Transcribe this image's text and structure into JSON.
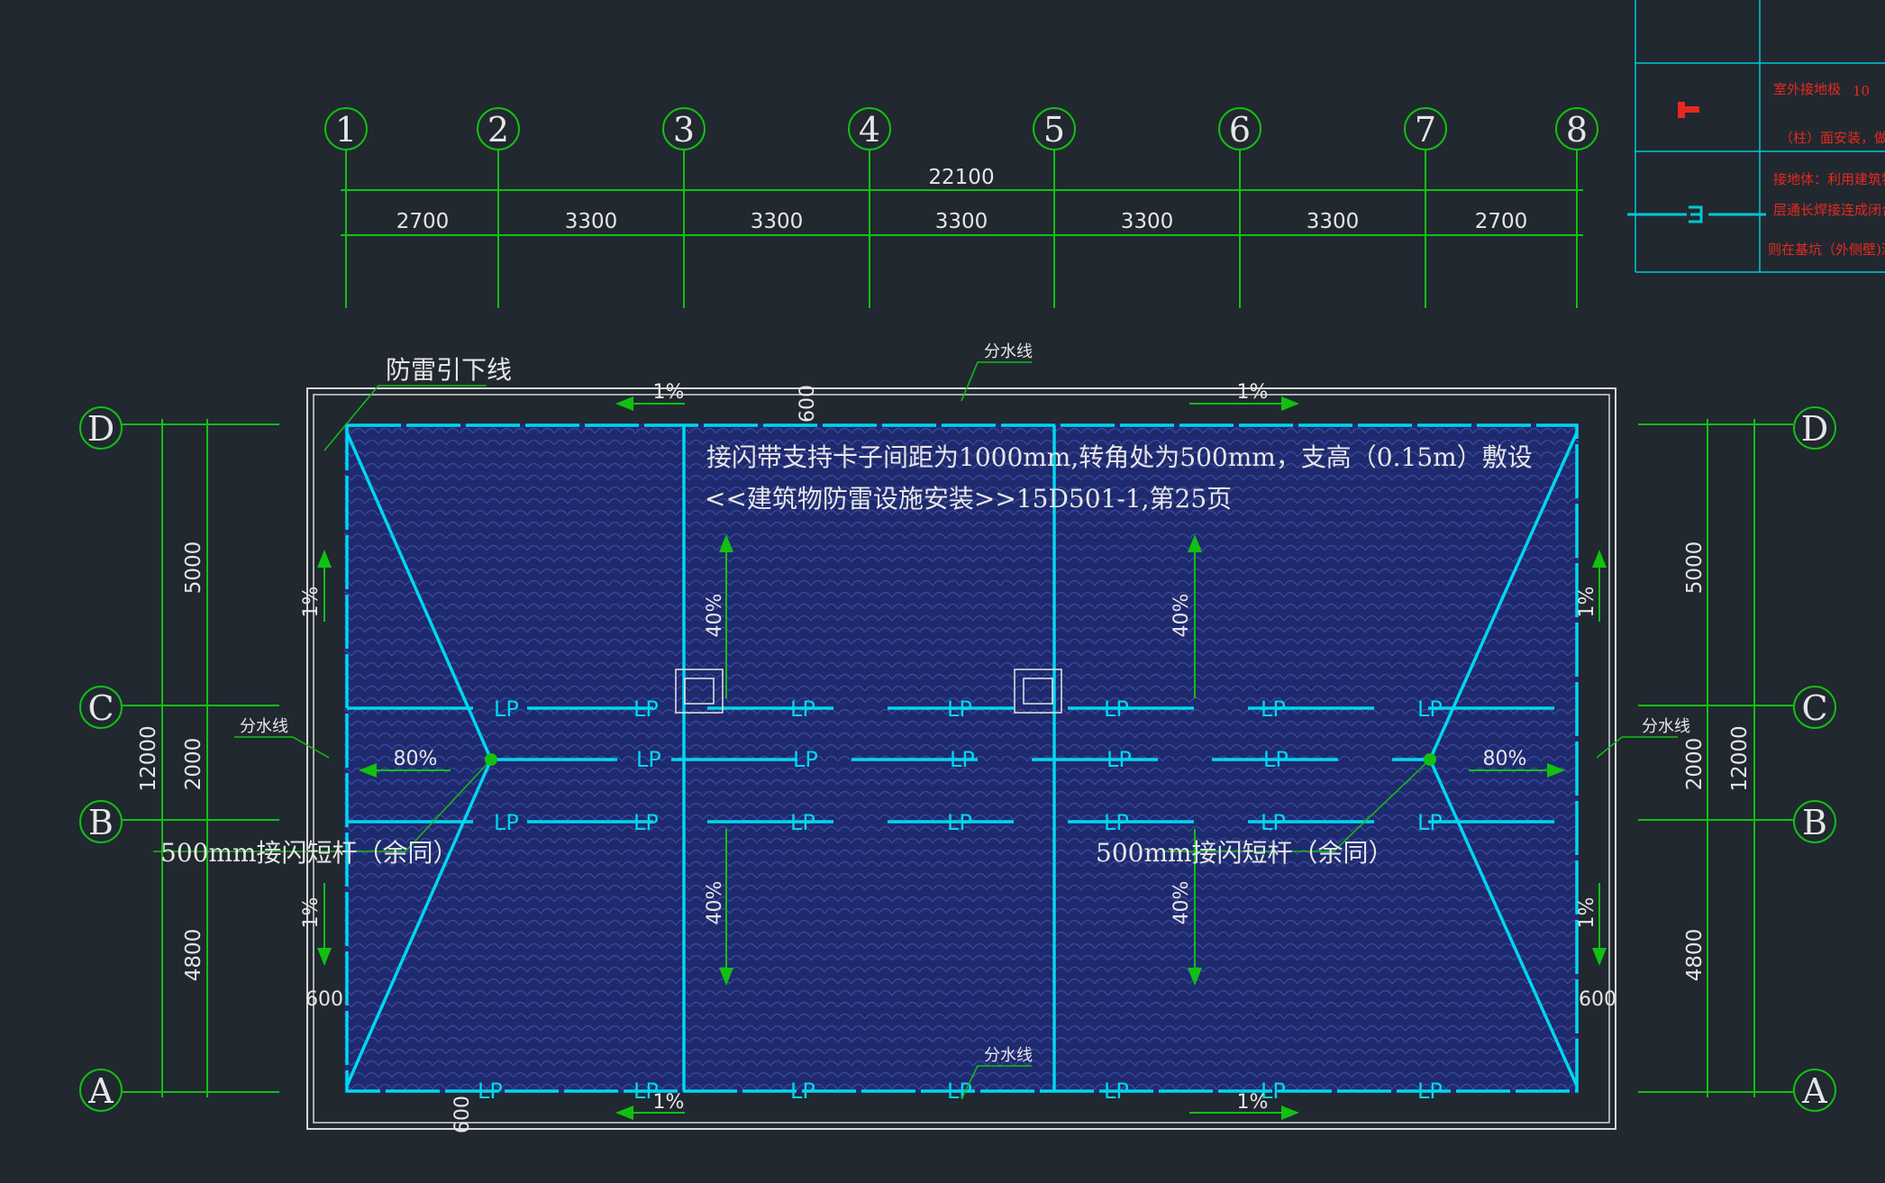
{
  "axes_top": [
    "1",
    "2",
    "3",
    "4",
    "5",
    "6",
    "7",
    "8"
  ],
  "axes_side": [
    "D",
    "C",
    "B",
    "A"
  ],
  "dims_top": {
    "total": "22100",
    "segments": [
      "2700",
      "3300",
      "3300",
      "3300",
      "3300",
      "3300",
      "2700"
    ]
  },
  "dims_left": {
    "total": "12000",
    "segments": [
      "5000",
      "2000",
      "4800"
    ]
  },
  "dims_right": {
    "total": "12000",
    "segments": [
      "5000",
      "2000",
      "4800"
    ]
  },
  "labels": {
    "downlead": "防雷引下线",
    "ridge_top": "分水线",
    "ridge_bottom": "分水线",
    "ridge_left": "分水线",
    "ridge_right": "分水线",
    "note_line1": "接闪带支持卡子间距为1000mm,转角处为500mm，支高（0.15m）敷设",
    "note_line2": "<<建筑物防雷设施安装>>15D501-1,第25页",
    "rod_left": "500mm接闪短杆（余同）",
    "rod_right": "500mm接闪短杆（余同）",
    "lp": "LP"
  },
  "slopes": {
    "one_percent": "1%",
    "forty_percent": "40%",
    "eighty_percent": "80%",
    "offset_600": "600"
  },
  "legend": {
    "row1_text": "室外接地极",
    "row1_code": "10",
    "row2_text": "（柱）面安装，做法",
    "row3_text": "接地体：利用建筑物",
    "row4_text": "层通长焊接连成闭合",
    "row5_text": "则在基坑（外侧壁)深"
  },
  "colors": {
    "background": "#212830",
    "grid": "#11c011",
    "roof_fill": "#1f2a6e",
    "lightning": "#00d7f0",
    "legend_line": "#00c8d8",
    "legend_text": "#e8281e"
  }
}
